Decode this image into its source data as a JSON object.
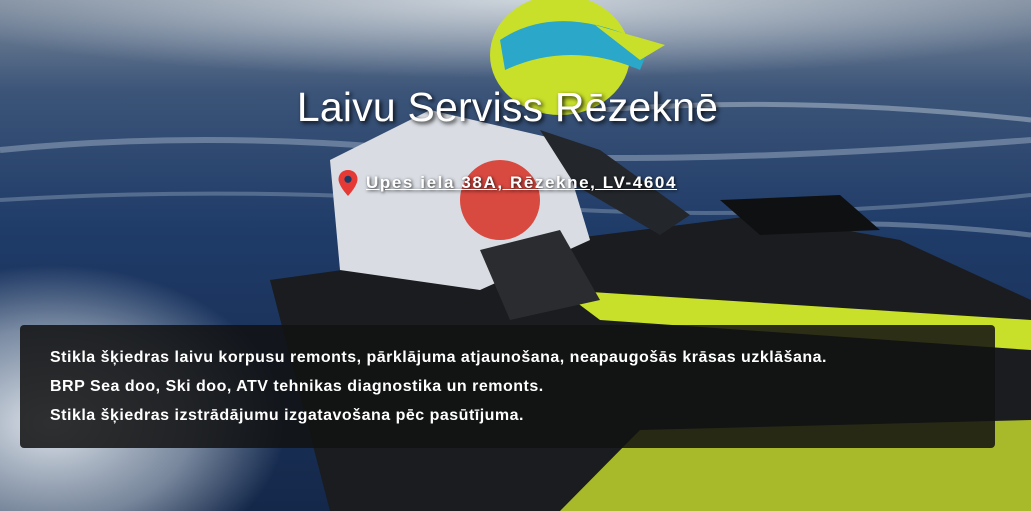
{
  "hero": {
    "title": "Laivu Serviss Rēzeknē",
    "address": {
      "icon": "map-pin-icon",
      "text": "Upes iela 38A, Rēzekne, LV-4604",
      "icon_color": "#e53935"
    }
  },
  "services": {
    "lines": [
      "Stikla šķiedras laivu korpusu remonts, pārklājuma atjaunošana, neapaugošās krāsas uzklāšana.",
      "BRP Sea doo, Ski doo, ATV tehnikas diagnostika un remonts.",
      "Stikla šķiedras izstrādājumu izgatavošana pēc pasūtījuma."
    ]
  },
  "colors": {
    "water": "#1c3a66",
    "jetski_accent": "#c9e02a",
    "box_background": "#121212"
  }
}
